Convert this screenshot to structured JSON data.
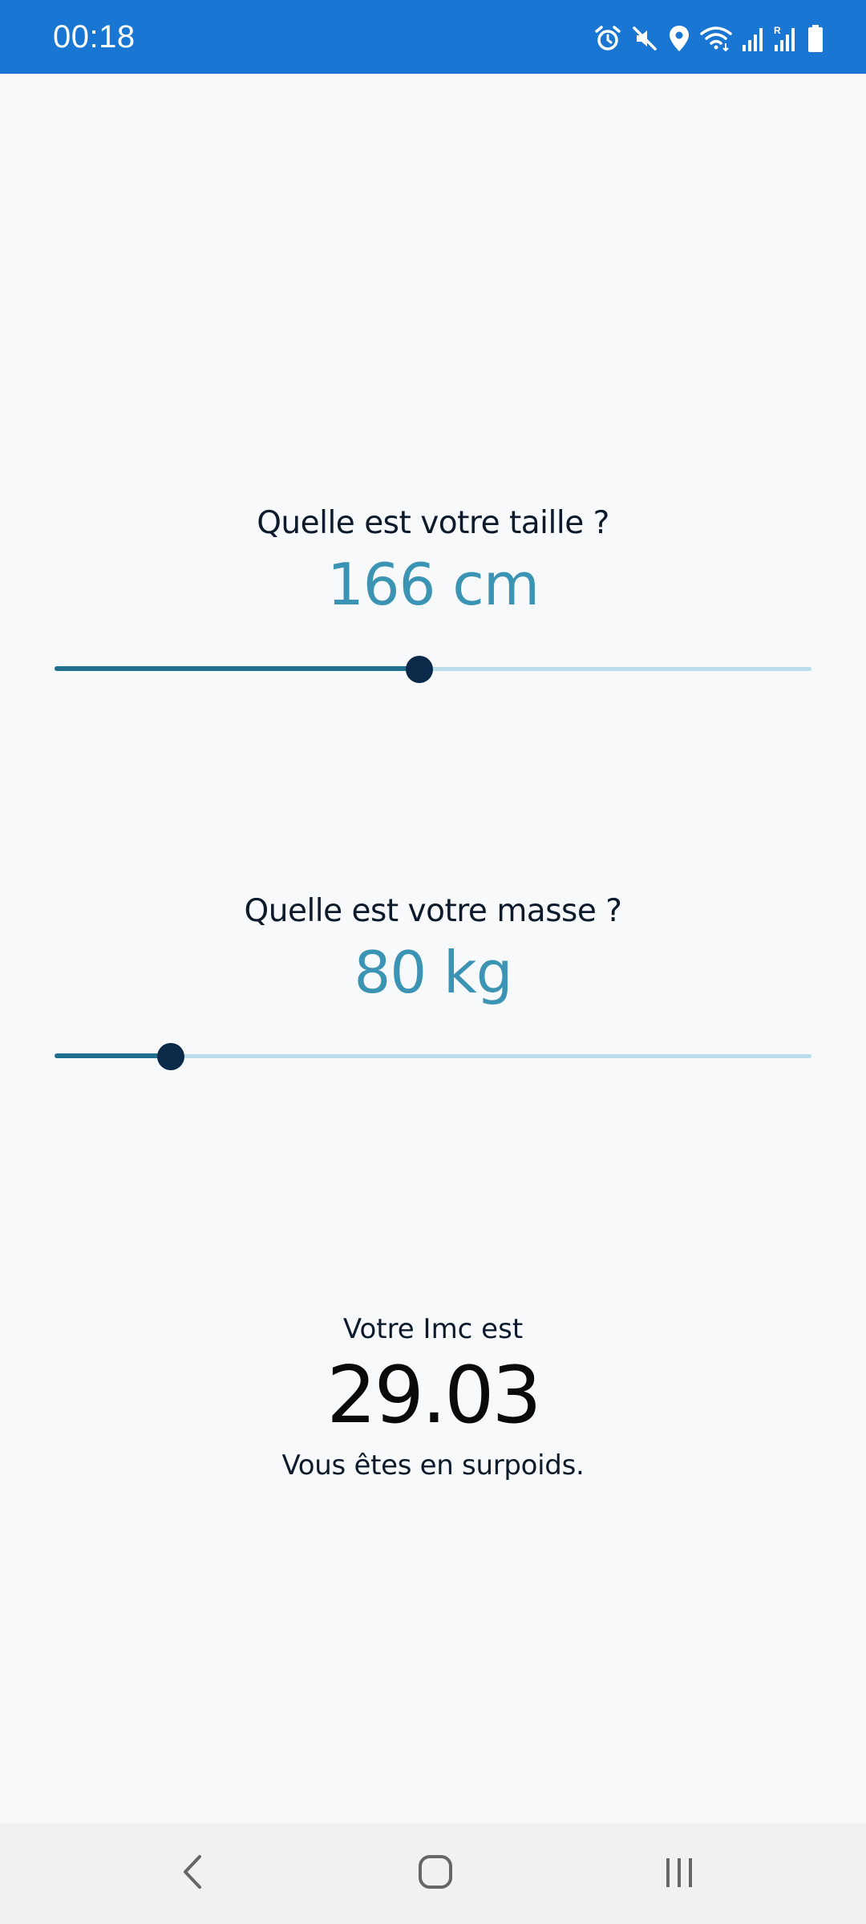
{
  "status_bar": {
    "time": "00:18",
    "background": "#1976d2",
    "icons": [
      "alarm-icon",
      "mute-icon",
      "location-icon",
      "wifi-icon",
      "signal-icon",
      "signal-roaming-icon",
      "battery-icon"
    ]
  },
  "height_section": {
    "question": "Quelle est votre taille ?",
    "value_text": "166 cm",
    "slider_fraction": 0.482
  },
  "mass_section": {
    "question": "Quelle est votre masse ?",
    "value_text": "80 kg",
    "slider_fraction": 0.154
  },
  "result": {
    "label": "Votre Imc est",
    "value": "29.03",
    "status": "Vous êtes en surpoids."
  },
  "colors": {
    "accent_value": "#3b94b3",
    "slider_active": "#1f6f8f",
    "slider_inactive": "#b9dde9",
    "slider_thumb": "#0b2a4a"
  },
  "nav_bar": {
    "buttons": [
      "back-icon",
      "home-icon",
      "recents-icon"
    ]
  }
}
